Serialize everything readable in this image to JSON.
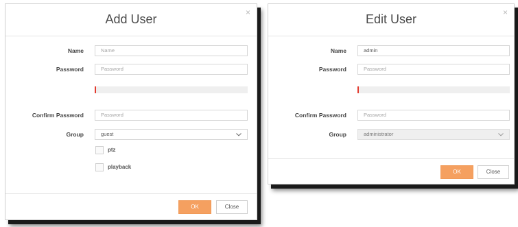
{
  "add_user": {
    "title": "Add User",
    "close_glyph": "×",
    "name_label": "Name",
    "name_placeholder": "Name",
    "password_label": "Password",
    "password_placeholder": "Password",
    "confirm_label": "Confirm Password",
    "confirm_placeholder": "Password",
    "group_label": "Group",
    "group_value": "guest",
    "permissions": [
      {
        "label": "ptz",
        "checked": false
      },
      {
        "label": "playback",
        "checked": false
      }
    ],
    "ok_label": "OK",
    "close_label": "Close"
  },
  "edit_user": {
    "title": "Edit User",
    "close_glyph": "×",
    "name_label": "Name",
    "name_value": "admin",
    "password_label": "Password",
    "password_placeholder": "Password",
    "confirm_label": "Confirm Password",
    "confirm_placeholder": "Password",
    "group_label": "Group",
    "group_value": "administrator",
    "ok_label": "OK",
    "close_label": "Close"
  },
  "colors": {
    "accent": "#f5a060",
    "strength_bar": "#e33b2f"
  },
  "icons": {
    "close": "close-icon",
    "dropdown": "chevron-down-icon"
  }
}
